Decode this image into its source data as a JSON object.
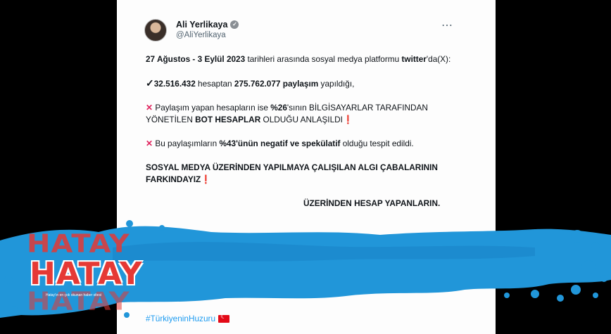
{
  "tweet": {
    "author": {
      "display_name": "Ali Yerlikaya",
      "handle": "@AliYerlikaya",
      "verified_mark": "✓"
    },
    "more_icon": "⋯",
    "lines": {
      "date_range": "27 Ağustos - 3 Eylül 2023",
      "intro_rest": " tarihleri arasında sosyal medya platformu",
      "platform": "twitter",
      "platform_rest": "'da(X):",
      "accounts": "32.516.432",
      "accounts_rest": " hesaptan ",
      "posts": "275.762.077 paylaşım",
      "posts_rest": " yapıldığı,",
      "bot_pre": " Paylaşım yapan hesapların ise ",
      "bot_pct": "%26",
      "bot_mid": "'sının BİLGİSAYARLAR TARAFINDAN YÖNETİLEN ",
      "bot_bold": "BOT HESAPLAR",
      "bot_post": " OLDUĞU ANLAŞILDI",
      "neg_pre": " Bu paylaşımların ",
      "neg_bold": "%43'ünün negatif ve spekülatif",
      "neg_post": " olduğu tespit edildi.",
      "closing": "SOSYAL MEDYA ÜZERİNDEN YAPILMAYA ÇALIŞILAN ALGI ÇABALARININ FARKINDAYIZ",
      "partial_line": "ÜZERİNDEN HESAP YAPANLARIN."
    },
    "hashtag": "#TürkiyeninHuzuru"
  },
  "logo": {
    "word": "HATAY",
    "tagline": "Hatay'ın en çok okunan haber sitesi"
  },
  "colors": {
    "accent_red": "#e53935",
    "paint_blue": "#2196d9",
    "link_blue": "#1d9bf0"
  }
}
